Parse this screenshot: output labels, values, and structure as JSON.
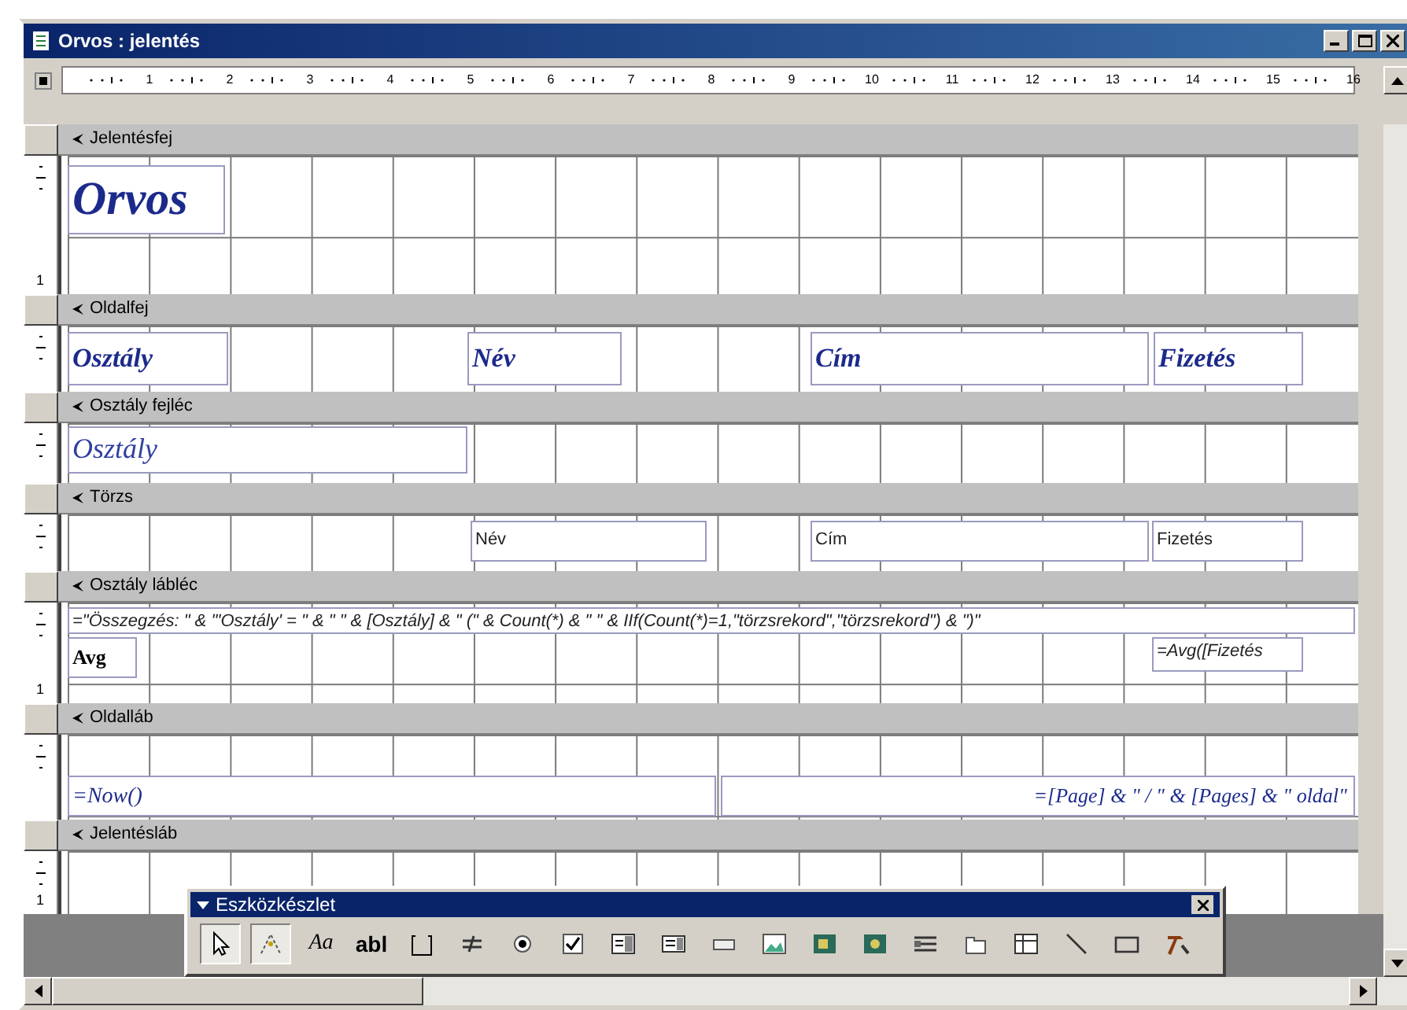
{
  "window": {
    "title": "Orvos : jelentés"
  },
  "ruler": {
    "marks": [
      "1",
      "2",
      "3",
      "4",
      "5",
      "6",
      "7",
      "8",
      "9",
      "10",
      "11",
      "12",
      "13",
      "14",
      "15",
      "16"
    ]
  },
  "sections": [
    {
      "title": "Jelentésfej",
      "side_label": "1",
      "controls": [
        {
          "kind": "title",
          "text": "Orvos"
        }
      ]
    },
    {
      "title": "Oldalfej",
      "controls": [
        {
          "kind": "heading",
          "text": "Osztály"
        },
        {
          "kind": "heading",
          "text": "Név"
        },
        {
          "kind": "heading",
          "text": "Cím"
        },
        {
          "kind": "heading",
          "text": "Fizetés"
        }
      ]
    },
    {
      "title": "Osztály fejléc",
      "controls": [
        {
          "kind": "group",
          "text": "Osztály"
        }
      ]
    },
    {
      "title": "Törzs",
      "controls": [
        {
          "kind": "field",
          "text": "Név"
        },
        {
          "kind": "field",
          "text": "Cím"
        },
        {
          "kind": "field",
          "text": "Fizetés"
        }
      ]
    },
    {
      "title": "Osztály lábléc",
      "side_label": "1",
      "controls": [
        {
          "kind": "expression",
          "text": "=\"Összegzés: \" & \"'Osztály' = \" & \" \" & [Osztály] & \" (\" & Count(*) & \" \" & IIf(Count(*)=1,\"törzsrekord\",\"törzsrekord\") & \")\""
        },
        {
          "kind": "label",
          "text": "Avg"
        },
        {
          "kind": "expression",
          "text": "=Avg([Fizetés"
        }
      ]
    },
    {
      "title": "Oldalláb",
      "controls": [
        {
          "kind": "date",
          "text": "=Now()"
        },
        {
          "kind": "page",
          "text": "=[Page] & \" / \" & [Pages] & \" oldal\""
        }
      ]
    },
    {
      "title": "Jelentésláb",
      "side_label": "1"
    }
  ],
  "toolbox": {
    "title": "Eszközkészlet",
    "tools": [
      {
        "kind": "pointer",
        "selected": true
      },
      {
        "kind": "wizard",
        "selected": true
      },
      {
        "kind": "label",
        "label": "Aa",
        "selected": false
      },
      {
        "kind": "textbox",
        "label": "abl",
        "selected": false
      },
      {
        "kind": "frame",
        "selected": false
      },
      {
        "kind": "toggle",
        "selected": false
      },
      {
        "kind": "option",
        "selected": false
      },
      {
        "kind": "checkbox",
        "selected": false
      },
      {
        "kind": "combo",
        "selected": false
      },
      {
        "kind": "list",
        "selected": false
      },
      {
        "kind": "command",
        "selected": false
      },
      {
        "kind": "image",
        "selected": false
      },
      {
        "kind": "unbound",
        "selected": false
      },
      {
        "kind": "bound",
        "selected": false
      },
      {
        "kind": "pagebreak",
        "selected": false
      },
      {
        "kind": "tab",
        "selected": false
      },
      {
        "kind": "subreport",
        "selected": false
      },
      {
        "kind": "line",
        "selected": false
      },
      {
        "kind": "rectangle",
        "selected": false
      },
      {
        "kind": "more",
        "selected": false
      }
    ]
  }
}
